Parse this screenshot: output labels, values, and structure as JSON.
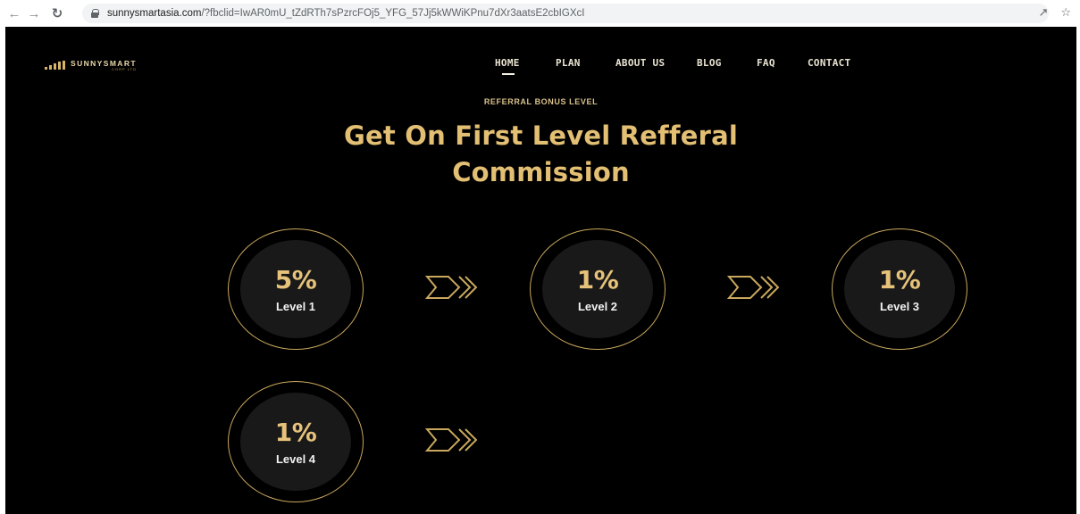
{
  "browser": {
    "url_host": "sunnysmartasia.com",
    "url_path": "/?fbclid=IwAR0mU_tZdRTh7sPzrcFOj5_YFG_57Jj5kWWiKPnu7dXr3aatsE2cbIGXcI"
  },
  "brand": {
    "name": "SUNNYSMART",
    "sub": "CORP LTD"
  },
  "nav": {
    "items": [
      {
        "label": "HOME",
        "active": true
      },
      {
        "label": "PLAN",
        "active": false
      },
      {
        "label": "ABOUT US",
        "active": false
      },
      {
        "label": "BLOG",
        "active": false
      },
      {
        "label": "FAQ",
        "active": false
      },
      {
        "label": "CONTACT",
        "active": false
      }
    ]
  },
  "section": {
    "subtitle": "REFERRAL BONUS LEVEL",
    "title_line1": "Get On First Level Refferal",
    "title_line2": "Commission"
  },
  "levels": [
    {
      "percent": "5%",
      "label": "Level 1"
    },
    {
      "percent": "1%",
      "label": "Level 2"
    },
    {
      "percent": "1%",
      "label": "Level 3"
    },
    {
      "percent": "1%",
      "label": "Level 4"
    }
  ],
  "colors": {
    "gold": "#e3bf73",
    "background": "#000000",
    "disc": "#191919"
  }
}
